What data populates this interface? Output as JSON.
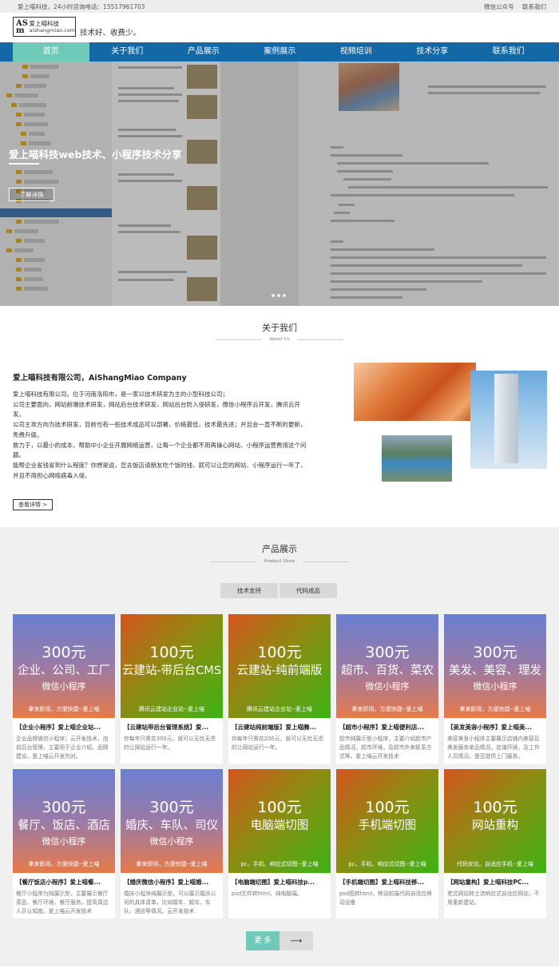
{
  "topbar": {
    "left": "爱上喵科技，24小时咨询电话：15517961703",
    "wechat": "微信公众号",
    "contact": "联系我们"
  },
  "header": {
    "logo_mark": "AS m",
    "logo_cn": "爱上喵科技",
    "logo_en": "aishangmiao.com",
    "slogan": "技术好、收费少。"
  },
  "nav": [
    "首页",
    "关于我们",
    "产品展示",
    "案例展示",
    "视频培训",
    "技术分享",
    "联系我们"
  ],
  "hero": {
    "title": "爱上喵科技web技术、小程序技术分享",
    "button": "了解详情"
  },
  "about": {
    "title": "关于我们",
    "subtitle": "About Us",
    "company": "爱上喵科技有限公司，AiShangMiao Company",
    "paragraphs": [
      "爱上喵科技有限公司，位于河南洛阳市，是一家以技术研发为主的小型科技公司；",
      "公司主要面向，网站前端技术研发，网站后台技术研发，网站后台防入侵研发，微信小程序云开发，腾讯云开发。",
      "公司主攻方向为技术研发，目前也有一些技术成品可以部署，价格最低，技术最先进；并且会一直不断的更新，免费升级。",
      "致力于，以最小的成本，帮助中小企业开展网络运营，让每一个企业都不用再操心网站、小程序运营费用这个问题。",
      "能帮企业省钱省到什么程度？你想是说，您去饭店请朋友吃个饭的钱，就可以让您的网站、小程序运行一年了，并且不用担心网络病毒入侵。"
    ],
    "more": "查看详情 >"
  },
  "products": {
    "title": "产品展示",
    "subtitle": "Product Show",
    "tabs": [
      "技术支持",
      "代码成品"
    ],
    "more": "更 多",
    "arrow": "⟶",
    "cards": [
      {
        "price": "300元",
        "tags": "企业、公司、工厂",
        "kind": "微信小程序",
        "foot": "拿来即用，方便快捷--爱上喵",
        "style": "g1",
        "title": "【企业小程序】爱上喵企业站...",
        "desc": "企业品牌微信小程序；云开发技术，由前后台管理，主要用于企业介绍，品牌建设。爱上喵云开发列对。"
      },
      {
        "price": "100元",
        "tags": "云建站-带后台CMS",
        "kind": "",
        "foot": "腾讯云建站企业站--爱上喵",
        "style": "g2",
        "title": "【云建站带后台管理系统】爱...",
        "desc": "你每年只需花300元，就可以无忧无虑的让网站运行一年。"
      },
      {
        "price": "100元",
        "tags": "云建站-纯前端版",
        "kind": "",
        "foot": "腾讯云建站企业站--爱上喵",
        "style": "g2",
        "title": "【云建站纯前端版】爱上喵腾...",
        "desc": "你每年只需花200元，就可以无忧无虑的让网站运行一年。"
      },
      {
        "price": "300元",
        "tags": "超市、百货、菜农",
        "kind": "微信小程序",
        "foot": "拿来即用，方便快捷--爱上喵",
        "style": "g1",
        "title": "【超市小程序】爱上喵便利店...",
        "desc": "超市纯展示型小程序，主要介绍超市产品情况，超市环境，及超市外卖联系方式等。爱上喵云开发技术"
      },
      {
        "price": "300元",
        "tags": "美发、美容、理发",
        "kind": "微信小程序",
        "foot": "拿来即用，方便快捷--爱上喵",
        "style": "g1",
        "title": "【美发美容小程序】爱上喵美...",
        "desc": "美容美发小程序主要展示店铺内美容及美发服务单品情况，店铺环境，及工作人员情况，是否提供上门服务。"
      },
      {
        "price": "300元",
        "tags": "餐厅、饭店、酒店",
        "kind": "微信小程序",
        "foot": "拿来即用，方便快捷--爱上喵",
        "style": "g1",
        "title": "【餐厅饭店小程序】爱上喵餐...",
        "desc": "餐厅小程序为纯展示型，主要展示餐厅菜品、餐厅环境、餐厅服务，提高周边人员认知度。爱上喵云开发技术"
      },
      {
        "price": "300元",
        "tags": "婚庆、车队、司仪",
        "kind": "微信小程序",
        "foot": "拿来即用，方便快捷--爱上喵",
        "style": "g1",
        "title": "【婚庆微信小程序】爱上喵婚...",
        "desc": "婚庆小程序纯展示型，可以展示婚庆公司的具体清单，比如婚车、婚车、车队、酒店等情况。云开发技术"
      },
      {
        "price": "100元",
        "tags": "电脑端切图",
        "kind": "",
        "foot": "pc、手机、响应式切图--爱上喵",
        "style": "g2",
        "title": "【电脑端切图】爱上喵科技p...",
        "desc": "psd文件转html，纯电脑端。"
      },
      {
        "price": "100元",
        "tags": "手机端切图",
        "kind": "",
        "foot": "pc、手机、响应式切图--爱上喵",
        "style": "g2",
        "title": "【手机端切图】爱上喵科技移...",
        "desc": "psd图转html，移动前端代码自适应移动设备"
      },
      {
        "price": "100元",
        "tags": "网站重构",
        "kind": "",
        "foot": "代码优化、自适应手机--爱上喵",
        "style": "g2",
        "title": "【网站重构】爱上喵科技PC...",
        "desc": "老式网站转士流响应式自适应网站，不用重新建站。"
      }
    ]
  }
}
